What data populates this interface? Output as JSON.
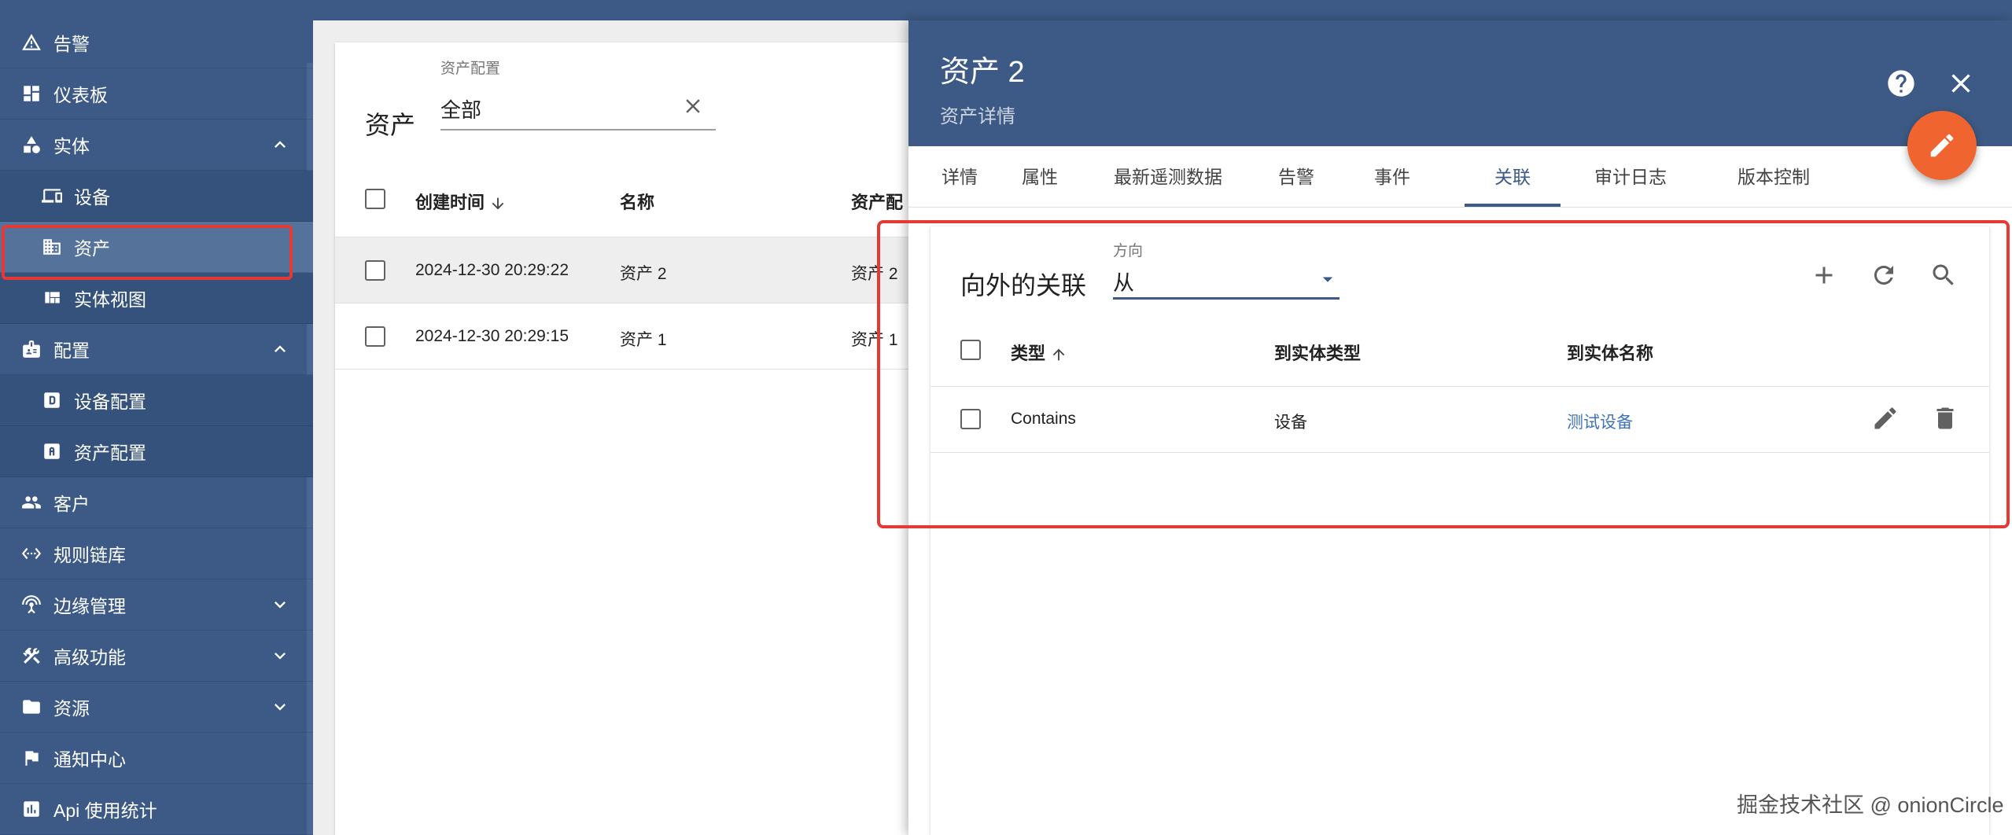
{
  "sidebar": {
    "items": [
      {
        "label": "告警",
        "icon": "warning-icon"
      },
      {
        "label": "仪表板",
        "icon": "dashboard-icon"
      },
      {
        "label": "实体",
        "icon": "entity-icon",
        "expanded": true
      },
      {
        "label": "设备",
        "icon": "devices-icon",
        "sub": true
      },
      {
        "label": "资产",
        "icon": "domain-icon",
        "sub": true,
        "active": true
      },
      {
        "label": "实体视图",
        "icon": "view-quilt-icon",
        "sub": true
      },
      {
        "label": "配置",
        "icon": "badge-icon",
        "expanded": true
      },
      {
        "label": "设备配置",
        "icon": "device-profile-icon",
        "sub": true
      },
      {
        "label": "资产配置",
        "icon": "asset-profile-icon",
        "sub": true
      },
      {
        "label": "客户",
        "icon": "people-icon"
      },
      {
        "label": "规则链库",
        "icon": "code-icon"
      },
      {
        "label": "边缘管理",
        "icon": "router-icon",
        "collapsed": true
      },
      {
        "label": "高级功能",
        "icon": "build-icon",
        "collapsed": true
      },
      {
        "label": "资源",
        "icon": "folder-icon",
        "collapsed": true
      },
      {
        "label": "通知中心",
        "icon": "flag-icon"
      },
      {
        "label": "Api 使用统计",
        "icon": "insert-chart-icon"
      }
    ]
  },
  "assets": {
    "title": "资产",
    "filter": {
      "label": "资产配置",
      "value": "全部"
    },
    "columns": [
      "创建时间",
      "名称",
      "资产配"
    ],
    "rows": [
      {
        "created": "2024-12-30 20:29:22",
        "name": "资产 2",
        "profile": "资产 2"
      },
      {
        "created": "2024-12-30 20:29:15",
        "name": "资产 1",
        "profile": "资产 1"
      }
    ]
  },
  "detail": {
    "title": "资产 2",
    "subtitle": "资产详情",
    "tabs": [
      "详情",
      "属性",
      "最新遥测数据",
      "告警",
      "事件",
      "关联",
      "审计日志",
      "版本控制"
    ],
    "active_tab": "关联",
    "relations": {
      "title": "向外的关联",
      "direction": {
        "label": "方向",
        "value": "从"
      },
      "columns": [
        "类型",
        "到实体类型",
        "到实体名称"
      ],
      "rows": [
        {
          "type": "Contains",
          "to_entity_type": "设备",
          "to_entity_name": "测试设备"
        }
      ]
    }
  },
  "watermark": "掘金技术社区 @ onionCircle",
  "colors": {
    "primary": "#3c5a85",
    "accent": "#f0642f",
    "highlight": "#e53935",
    "link": "#3f73b7"
  }
}
